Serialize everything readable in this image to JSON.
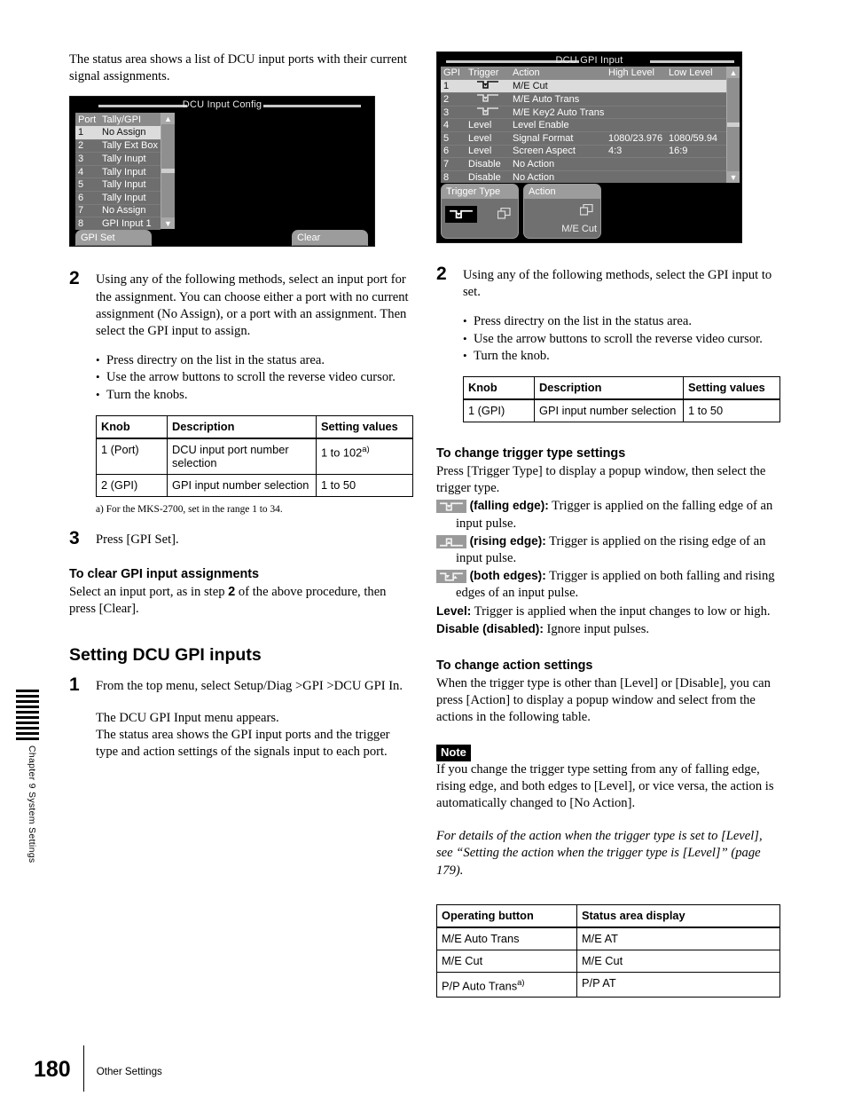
{
  "page": {
    "number": "180",
    "section_label": "Other Settings",
    "edge_tab": "Chapter 9  System Settings"
  },
  "left": {
    "intro": "The status area shows a list of DCU input ports with their current signal assignments.",
    "screenshot": {
      "title": "DCU Input Config",
      "columns": [
        "Port",
        "Tally/GPI"
      ],
      "rows": [
        {
          "port": "1",
          "value": "No Assign",
          "selected": true
        },
        {
          "port": "2",
          "value": "Tally Ext Box",
          "selected": false
        },
        {
          "port": "3",
          "value": "Tally Inupt",
          "selected": false
        },
        {
          "port": "4",
          "value": "Tally Input",
          "selected": false
        },
        {
          "port": "5",
          "value": "Tally Input",
          "selected": false
        },
        {
          "port": "6",
          "value": "Tally Input",
          "selected": false
        },
        {
          "port": "7",
          "value": "No Assign",
          "selected": false
        },
        {
          "port": "8",
          "value": "GPI Input 1",
          "selected": false
        }
      ],
      "buttons": [
        {
          "caption": "GPI Set",
          "value": ""
        },
        {
          "caption": "Clear",
          "value": ""
        }
      ],
      "scroll_up_icon": "triangle-up-icon",
      "scroll_down_icon": "triangle-down-icon"
    },
    "step2": {
      "num": "2",
      "text": "Using any of the following methods, select an input port for the assignment. You can choose either a port with no current assignment (No Assign), or a port with an assignment. Then select the GPI input to assign.",
      "bullets": [
        "Press directry on the list in the status area.",
        "Use the arrow buttons to scroll the reverse video cursor.",
        "Turn the knobs."
      ]
    },
    "knob_table": {
      "headers": [
        "Knob",
        "Description",
        "Setting values"
      ],
      "rows": [
        {
          "knob": "1 (Port)",
          "desc": "DCU input port number selection",
          "values": "1 to 102",
          "values_sup": "a)"
        },
        {
          "knob": "2 (GPI)",
          "desc": "GPI input number selection",
          "values": "1 to 50",
          "values_sup": ""
        }
      ]
    },
    "footnote": "a) For the MKS-2700, set in the range 1 to 34.",
    "step3": {
      "num": "3",
      "text": "Press [GPI Set]."
    },
    "clear_heading": "To clear GPI input assignments",
    "clear_text_1": "Select an input port, as in step ",
    "clear_text_bold": "2",
    "clear_text_2": " of the above procedure, then press [Clear].",
    "section_heading": "Setting DCU GPI inputs",
    "step1": {
      "num": "1",
      "text": "From the top menu, select Setup/Diag >GPI >DCU GPI In.",
      "para2_line1": "The DCU GPI Input menu appears.",
      "para2_line2": "The status area shows the GPI input ports and the trigger type and action settings of the signals input to each port."
    }
  },
  "right": {
    "screenshot": {
      "title": "DCU GPI Input",
      "columns": [
        "GPI",
        "Trigger",
        "Action",
        "High Level",
        "Low Level"
      ],
      "rows": [
        {
          "gpi": "1",
          "trigger": "falling-edge-icon",
          "trigger_text": "",
          "action": "M/E Cut",
          "high": "",
          "low": "",
          "selected": true
        },
        {
          "gpi": "2",
          "trigger": "falling-edge-icon",
          "trigger_text": "",
          "action": "M/E Auto Trans",
          "high": "",
          "low": "",
          "selected": false
        },
        {
          "gpi": "3",
          "trigger": "falling-edge-icon",
          "trigger_text": "",
          "action": "M/E Key2 Auto Trans",
          "high": "",
          "low": "",
          "selected": false
        },
        {
          "gpi": "4",
          "trigger": "",
          "trigger_text": "Level",
          "action": "Level Enable",
          "high": "",
          "low": "",
          "selected": false
        },
        {
          "gpi": "5",
          "trigger": "",
          "trigger_text": "Level",
          "action": "Signal Format",
          "high": "1080/23.976",
          "low": "1080/59.94",
          "selected": false
        },
        {
          "gpi": "6",
          "trigger": "",
          "trigger_text": "Level",
          "action": "Screen Aspect",
          "high": "4:3",
          "low": "16:9",
          "selected": false
        },
        {
          "gpi": "7",
          "trigger": "",
          "trigger_text": "Disable",
          "action": "No Action",
          "high": "",
          "low": "",
          "selected": false
        },
        {
          "gpi": "8",
          "trigger": "",
          "trigger_text": "Disable",
          "action": "No Action",
          "high": "",
          "low": "",
          "selected": false
        }
      ],
      "buttons": [
        {
          "caption": "Trigger Type",
          "value": ""
        },
        {
          "caption": "Action",
          "value": "M/E Cut"
        }
      ],
      "scroll_up_icon": "triangle-up-icon",
      "scroll_down_icon": "triangle-down-icon"
    },
    "step2": {
      "num": "2",
      "text": "Using any of the following methods, select the GPI input to set.",
      "bullets": [
        "Press directry on the list in the status area.",
        "Use the arrow buttons to scroll the reverse video cursor.",
        "Turn the knob."
      ]
    },
    "knob_table": {
      "headers": [
        "Knob",
        "Description",
        "Setting values"
      ],
      "rows": [
        {
          "knob": "1 (GPI)",
          "desc": "GPI input number selection",
          "values": "1 to 50"
        }
      ]
    },
    "trigger_heading": "To change trigger type settings",
    "trigger_intro": "Press [Trigger Type] to display a popup window, then select the trigger type.",
    "trigger_items": [
      {
        "icon": "falling-edge-icon",
        "bold": "(falling edge):",
        "text": " Trigger is applied on the falling edge of an input pulse."
      },
      {
        "icon": "rising-edge-icon",
        "bold": "(rising edge):",
        "text": " Trigger is applied on the rising edge of an input pulse."
      },
      {
        "icon": "both-edges-icon",
        "bold": "(both edges):",
        "text": " Trigger is applied on both falling and rising edges of an input pulse."
      }
    ],
    "level_bold": "Level:",
    "level_text": " Trigger is applied when the input changes to low or high.",
    "disable_bold": "Disable (disabled):",
    "disable_text": " Ignore input pulses.",
    "action_heading": "To change action settings",
    "action_text": "When the trigger type is other than [Level] or [Disable], you can press [Action] to display a popup window and select from the actions in the following table.",
    "note_label": "Note",
    "note_text": "If you change the trigger type setting from any of falling edge, rising edge, and both edges to [Level], or vice versa, the action is automatically changed to [No Action].",
    "ref_text": "For details of the action when the trigger type is set to [Level], see “Setting the action when the trigger type is [Level]” (page 179).",
    "action_table": {
      "headers": [
        "Operating button",
        "Status area display"
      ],
      "rows": [
        {
          "button": "M/E Auto Trans",
          "button_sup": "",
          "display": "M/E AT"
        },
        {
          "button": "M/E Cut",
          "button_sup": "",
          "display": "M/E Cut"
        },
        {
          "button": "P/P Auto Trans",
          "button_sup": "a)",
          "display": "P/P AT"
        }
      ]
    }
  },
  "colors": {
    "shot_bg": "#000000",
    "list_bg": "#6e6e6e",
    "list_header": "#8a8a8a",
    "list_selected": "#dcdcdc",
    "button_face": "#707070",
    "button_cap": "#9c9c9c"
  }
}
